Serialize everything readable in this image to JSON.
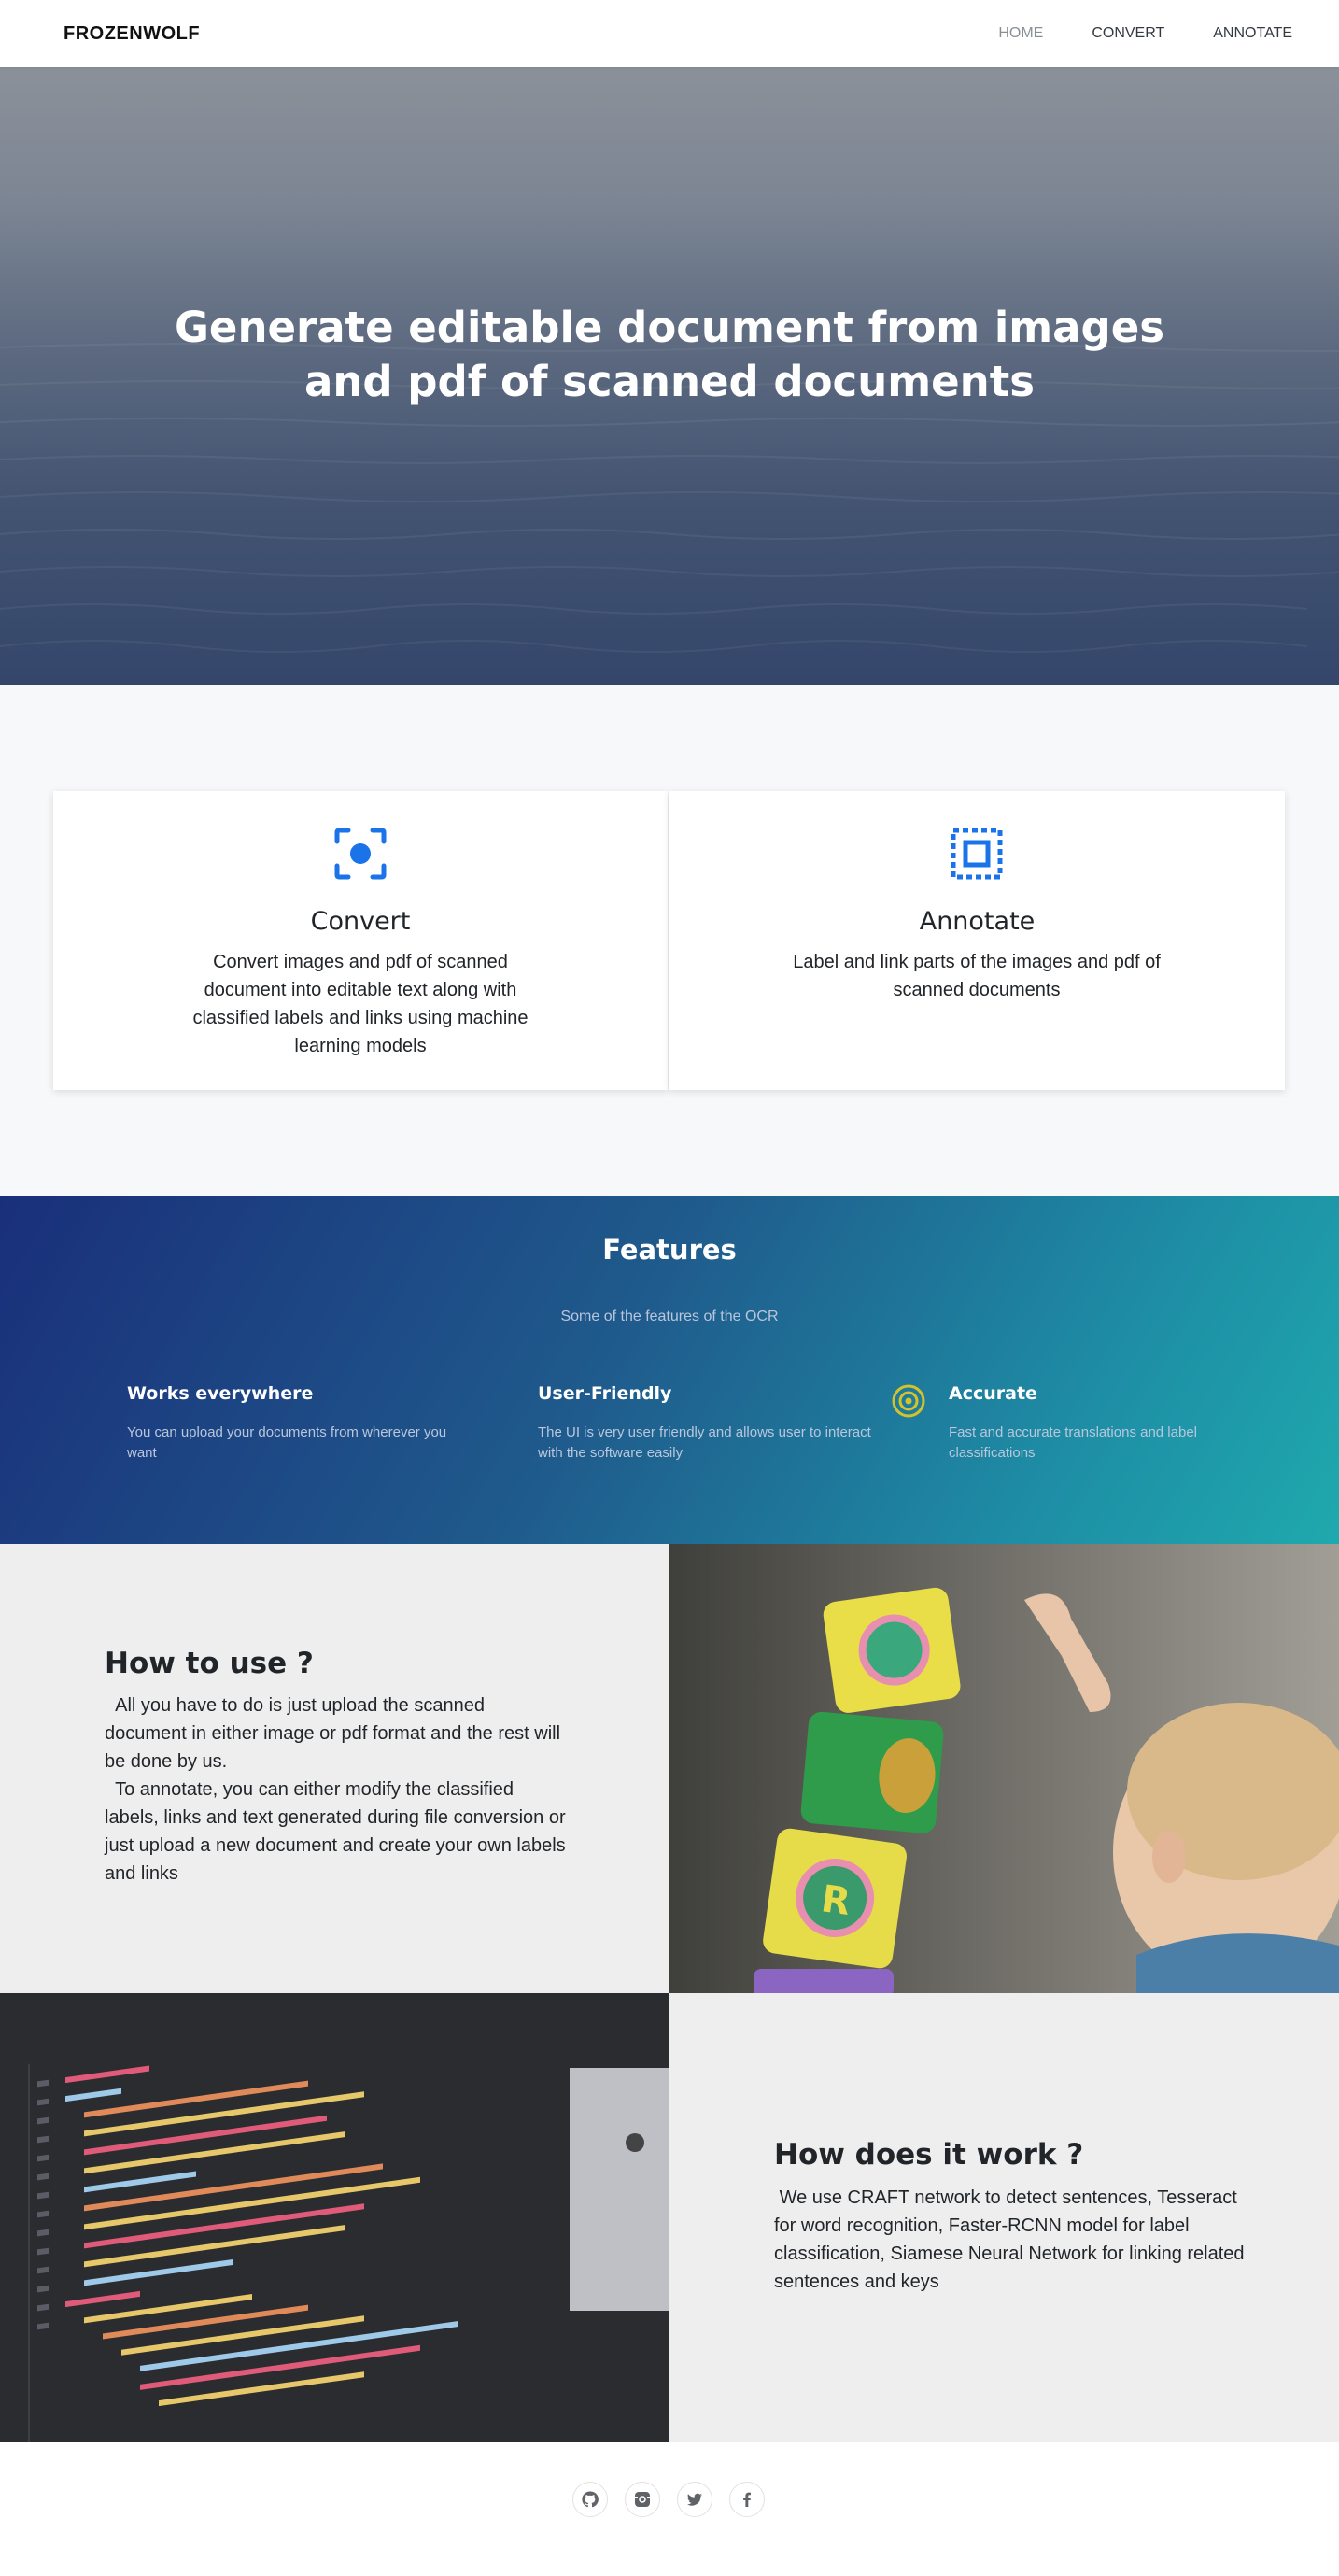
{
  "navbar": {
    "brand": "FROZENWOLF",
    "links": [
      {
        "label": "HOME",
        "active": true
      },
      {
        "label": "CONVERT",
        "active": false
      },
      {
        "label": "ANNOTATE",
        "active": false
      }
    ]
  },
  "hero": {
    "title_line1": "Generate editable document from  images",
    "title_line2": "and pdf of scanned documents"
  },
  "cards": [
    {
      "icon": "scan-icon",
      "title": "Convert",
      "text": "Convert images and pdf of scanned document into editable text along with classified labels and links using machine learning models"
    },
    {
      "icon": "select-icon",
      "title": "Annotate",
      "text": "Label and link parts of the images and pdf of scanned documents"
    }
  ],
  "features": {
    "title": "Features",
    "subtitle": "Some of the features of the OCR",
    "items": [
      {
        "title": "Works everywhere",
        "text": "You can upload your documents from wherever you want"
      },
      {
        "title": "User-Friendly",
        "text": "The UI is very user friendly and allows user to interact with the software easily"
      },
      {
        "title": "Accurate",
        "text": "Fast and  accurate translations and label classifications",
        "icon": "target-icon"
      }
    ]
  },
  "how_to_use": {
    "title": "How to use ?",
    "paragraph1": "  All you have to do is just upload the scanned document in either image or pdf format and the rest will be done by us.",
    "paragraph2": "  To annotate, you can either modify the classified labels, links and text generated during file conversion or just upload a new document and create your own labels and links"
  },
  "how_it_works": {
    "title": "How does it work ?",
    "text": " We use CRAFT network to detect sentences, Tesseract for word recognition, Faster-RCNN model for label classification, Siamese Neural Network for linking related sentences and keys"
  },
  "footer": {
    "social_icons": [
      "github-icon",
      "instagram-icon",
      "twitter-icon",
      "facebook-icon"
    ]
  },
  "colors": {
    "accent_blue": "#1a73e8",
    "features_gradient_start": "#1a2f7a",
    "features_gradient_end": "#1fa9ad",
    "target_icon": "#d4c22a"
  }
}
